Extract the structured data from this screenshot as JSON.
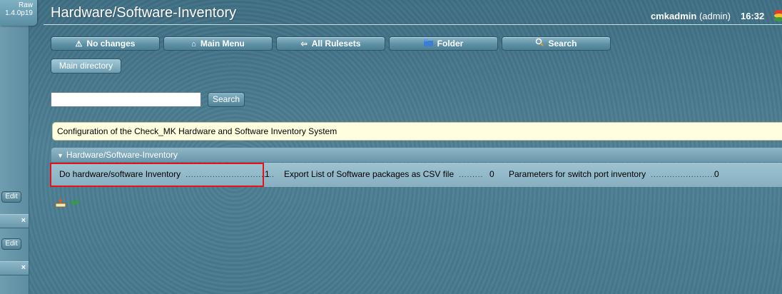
{
  "version": {
    "line1": "Raw",
    "line2": "1.4.0p19"
  },
  "sidebar": {
    "edit_label_1": "Edit",
    "edit_label_2": "Edit",
    "close_glyph": "×"
  },
  "header": {
    "title": "Hardware/Software-Inventory",
    "user": "cmkadmin",
    "role": "(admin)",
    "time": "16:32"
  },
  "context_buttons": [
    {
      "label": "No changes",
      "icon": "warning-icon"
    },
    {
      "label": "Main Menu",
      "icon": "home-icon"
    },
    {
      "label": "All Rulesets",
      "icon": "back-arrow-icon"
    },
    {
      "label": "Folder",
      "icon": "folder-icon"
    },
    {
      "label": "Search",
      "icon": "search-icon"
    }
  ],
  "main_directory_label": "Main directory",
  "search": {
    "value": "",
    "button_label": "Search"
  },
  "info_message": "Configuration of the Check_MK Hardware and Software Inventory System",
  "group": {
    "title": "Hardware/Software-Inventory",
    "rulesets": [
      {
        "label": "Do hardware/software Inventory",
        "count": "1"
      },
      {
        "label": "Export List of Software packages as CSV file",
        "count": "0"
      },
      {
        "label": "Parameters for switch port inventory",
        "count": "0"
      }
    ]
  },
  "colors": {
    "accent": "#4a7a8f",
    "info_bg": "#ffffdf",
    "highlight": "#e8101a"
  }
}
